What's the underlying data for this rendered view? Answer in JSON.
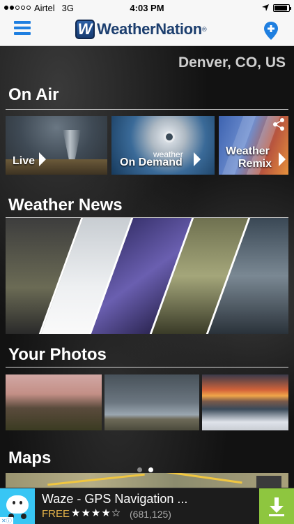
{
  "status_bar": {
    "carrier": "Airtel",
    "network": "3G",
    "time": "4:03 PM",
    "battery_level": 0.9
  },
  "header": {
    "logo_letter": "W",
    "logo_text": "WeatherNation",
    "logo_reg": "®",
    "menu_icon": "hamburger-menu-icon",
    "location_icon": "location-pin-icon",
    "accent_color": "#1f7fe0"
  },
  "location": "Denver, CO, US",
  "sections": {
    "on_air": {
      "title": "On Air",
      "tiles": [
        {
          "label": "Live"
        },
        {
          "small_label": "weather",
          "label": "On Demand"
        },
        {
          "label_line1": "Weather",
          "label_line2": "Remix"
        }
      ]
    },
    "weather_news": {
      "title": "Weather News"
    },
    "your_photos": {
      "title": "Your Photos"
    },
    "maps": {
      "title": "Maps",
      "page_count": 2,
      "active_page": 2
    }
  },
  "ad": {
    "title": "Waze - GPS Navigation ...",
    "price": "FREE",
    "stars": "★★★★☆",
    "rating": 4.5,
    "reviews": "(681,125)",
    "brand_color": "#38c6f4",
    "download_color": "#8ec63f"
  }
}
